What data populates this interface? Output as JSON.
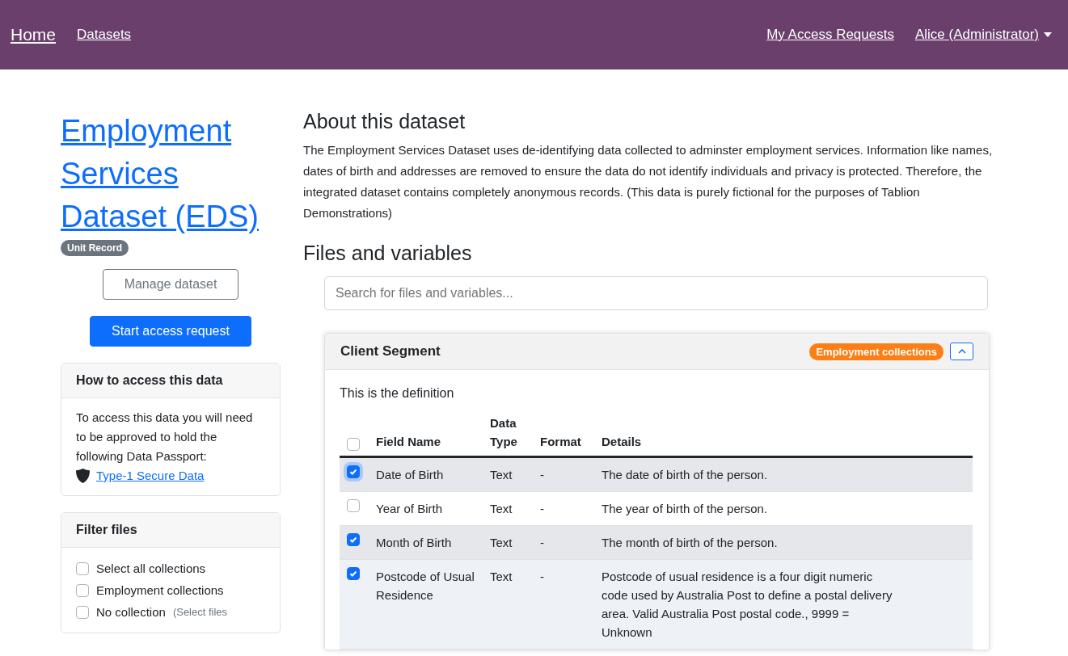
{
  "navbar": {
    "brand": "Home",
    "links": [
      "Datasets"
    ],
    "right_links": [
      "My Access Requests"
    ],
    "user_menu": "Alice (Administrator)"
  },
  "dataset": {
    "title": "Employment Services Dataset (EDS)",
    "badge": "Unit Record",
    "manage_button": "Manage dataset",
    "request_button": "Start access request"
  },
  "access_card": {
    "title": "How to access this data",
    "text": "To access this data you will need to be approved to hold the following Data Passport:",
    "passport_link": "Type-1 Secure Data"
  },
  "filter_card": {
    "title": "Filter files",
    "options": [
      {
        "label": "Select all collections",
        "checked": false
      },
      {
        "label": "Employment collections",
        "checked": false
      },
      {
        "label": "No collection",
        "note": "(Select files",
        "checked": false
      }
    ]
  },
  "about": {
    "heading": "About this dataset",
    "text": "The Employment Services Dataset uses de-identifying data collected to adminster employment services. Information like names, dates of birth and addresses are removed to ensure the data do not identify individuals and privacy is protected. Therefore, the integrated dataset contains completely anonymous records. (This data is purely fictional for the purposes of Tablion Demonstrations)"
  },
  "files": {
    "heading": "Files and variables",
    "search": {
      "placeholder": "Search for files and variables..."
    },
    "file": {
      "name": "Client Segment",
      "collection_badge": "Employment collections",
      "expanded": true,
      "definition": "This is the definition",
      "select_all_checked": false,
      "columns": [
        "Field Name",
        "Data Type",
        "Format",
        "Details"
      ],
      "rows": [
        {
          "name": "Date of Birth",
          "type": "Text",
          "format": "-",
          "details": "The date of birth of the person.",
          "checked": true,
          "focused": true,
          "hovered": false
        },
        {
          "name": "Year of Birth",
          "type": "Text",
          "format": "-",
          "details": "The year of birth of the person.",
          "checked": false,
          "focused": false,
          "hovered": false
        },
        {
          "name": "Month of Birth",
          "type": "Text",
          "format": "-",
          "details": "The month of birth of the person.",
          "checked": true,
          "focused": false,
          "hovered": false
        },
        {
          "name": "Postcode of Usual Residence",
          "type": "Text",
          "format": "-",
          "details": "Postcode of usual residence is a four digit numeric code used by Australia Post to define a postal delivery area. Valid Australia Post postal code., 9999 = Unknown",
          "checked": true,
          "focused": false,
          "hovered": true
        }
      ]
    }
  }
}
